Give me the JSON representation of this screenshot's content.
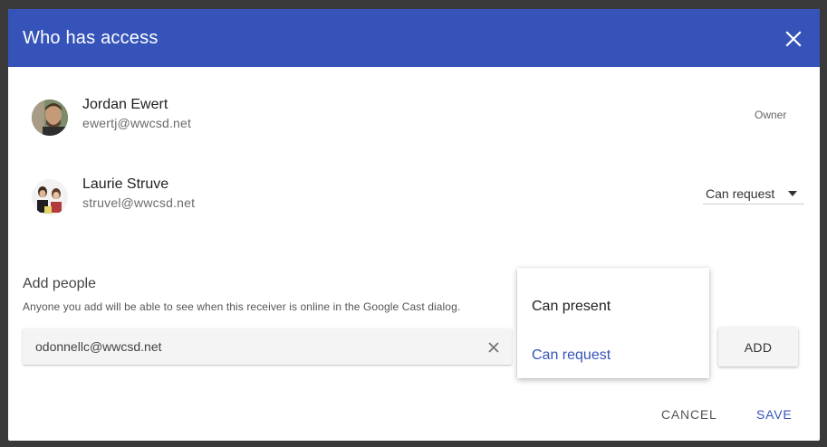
{
  "dialog": {
    "title": "Who has access"
  },
  "people": [
    {
      "name": "Jordan Ewert",
      "email": "ewertj@wwcsd.net",
      "role": "Owner"
    },
    {
      "name": "Laurie Struve",
      "email": "struvel@wwcsd.net",
      "role": "Can request"
    }
  ],
  "add_people": {
    "title": "Add people",
    "description": "Anyone you add will be able to see when this receiver is online in the Google Cast dialog.",
    "input_value": "odonnellc@wwcsd.net",
    "add_label": "ADD"
  },
  "role_menu": {
    "options": [
      "Can present",
      "Can request"
    ],
    "selected": "Can request"
  },
  "footer": {
    "cancel_label": "CANCEL",
    "save_label": "SAVE"
  },
  "colors": {
    "header": "#3553b9",
    "accent": "#3553b9",
    "background": "#3a3a3a"
  },
  "icons": {
    "close": "close-icon",
    "clear": "clear-icon",
    "dropdown": "dropdown-arrow-icon"
  }
}
